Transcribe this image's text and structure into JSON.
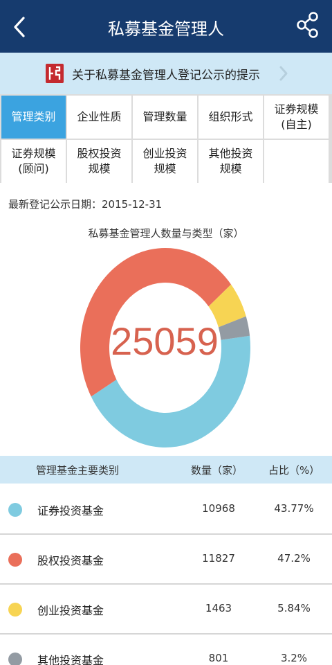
{
  "header": {
    "title": "私募基金管理人"
  },
  "notice": {
    "text": "关于私募基金管理人登记公示的提示"
  },
  "tabs": [
    {
      "label": "管理类别",
      "active": true
    },
    {
      "label": "企业性质",
      "active": false
    },
    {
      "label": "管理数量",
      "active": false
    },
    {
      "label": "组织形式",
      "active": false
    },
    {
      "label": "证券规模\n(自主)",
      "active": false
    },
    {
      "label": "证券规模\n(顾问)",
      "active": false
    },
    {
      "label": "股权投资\n规模",
      "active": false
    },
    {
      "label": "创业投资\n规模",
      "active": false
    },
    {
      "label": "其他投资\n规模",
      "active": false
    }
  ],
  "date_line": "最新登记公示日期：2015-12-31",
  "chart_title": "私募基金管理人数量与类型（家）",
  "chart_data": {
    "type": "pie",
    "total": "25059",
    "slices": [
      {
        "name": "证券投资基金",
        "value": 10968,
        "percent": 43.77,
        "color": "#7fcbe0"
      },
      {
        "name": "股权投资基金",
        "value": 11827,
        "percent": 47.2,
        "color": "#ea6f5a"
      },
      {
        "name": "创业投资基金",
        "value": 1463,
        "percent": 5.84,
        "color": "#f7d453"
      },
      {
        "name": "其他投资基金",
        "value": 801,
        "percent": 3.2,
        "color": "#939ba3"
      }
    ]
  },
  "table": {
    "headers": {
      "category": "管理基金主要类别",
      "count": "数量（家）",
      "percent": "占比（%）"
    },
    "rows": [
      {
        "name": "证券投资基金",
        "count": "10968",
        "percent": "43.77%",
        "color": "#7fcbe0"
      },
      {
        "name": "股权投资基金",
        "count": "11827",
        "percent": "47.2%",
        "color": "#ea6f5a"
      },
      {
        "name": "创业投资基金",
        "count": "1463",
        "percent": "5.84%",
        "color": "#f7d453"
      },
      {
        "name": "其他投资基金",
        "count": "801",
        "percent": "3.2%",
        "color": "#939ba3"
      }
    ]
  },
  "colors": {
    "header_bg": "#163b6e",
    "notice_bg": "#cfe8f6",
    "tab_active": "#3ba3e0",
    "total_text": "#d7624f"
  },
  "icons": {
    "back": "chevron-left-icon",
    "share": "share-icon",
    "notice_logo": "seal-logo-icon",
    "notice_arrow": "chevron-right-icon"
  }
}
